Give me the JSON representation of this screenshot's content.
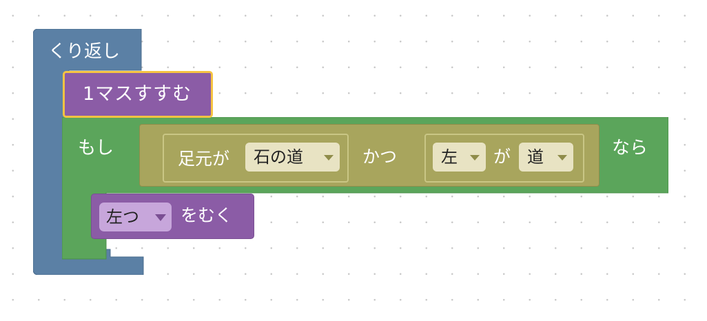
{
  "blocks": {
    "loop": {
      "label": "くり返し",
      "color": "#5b80a5"
    },
    "move": {
      "label": "1マスすすむ",
      "color": "#8b5ca6",
      "highlight": "#f6c342"
    },
    "if": {
      "label": "もし",
      "then_label": "なら",
      "color": "#5ba55b"
    },
    "and": {
      "connector": "かつ",
      "color": "#a8a55d",
      "left": {
        "label": "足元が",
        "dropdown": "石の道"
      },
      "right": {
        "dropdown_a": "左",
        "middle": "が",
        "dropdown_b": "道"
      }
    },
    "turn": {
      "dropdown": "左つ",
      "label": "をむく",
      "color": "#8b5ca6"
    }
  }
}
